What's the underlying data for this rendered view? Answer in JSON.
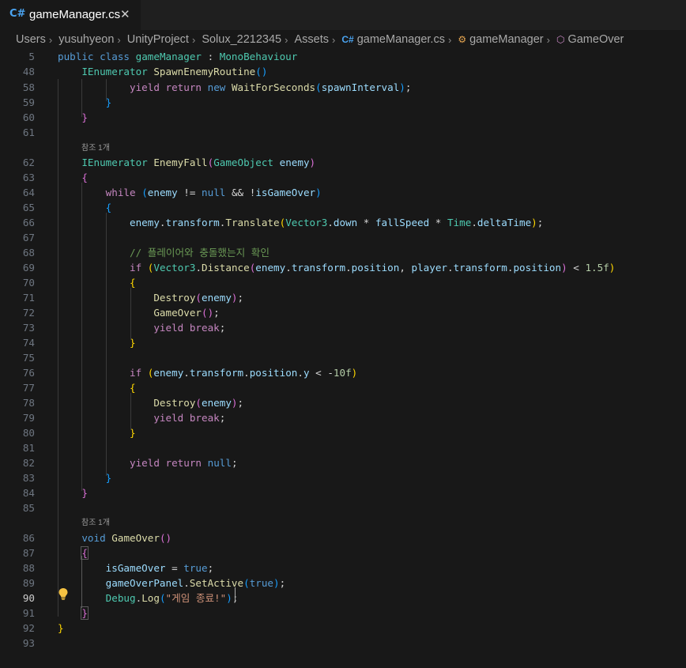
{
  "tab": {
    "icon": "csharp-icon",
    "label": "gameManager.cs",
    "close_glyph": "✕"
  },
  "breadcrumb": {
    "items": [
      "Users",
      "yusuhyeon",
      "UnityProject",
      "Solux_2212345",
      "Assets",
      "gameManager.cs",
      "gameManager",
      "GameOver"
    ]
  },
  "codelens": {
    "ref1": "참조 1개",
    "ref2": "참조 1개"
  },
  "sticky": [
    {
      "ln": "5",
      "tokens": [
        [
          "kw",
          "public"
        ],
        [
          "op",
          " "
        ],
        [
          "kw",
          "class"
        ],
        [
          "op",
          " "
        ],
        [
          "ty",
          "gameManager"
        ],
        [
          "op",
          " : "
        ],
        [
          "ty",
          "MonoBehaviour"
        ]
      ]
    },
    {
      "ln": "48",
      "tokens": [
        [
          "op",
          "    "
        ],
        [
          "ty",
          "IEnumerator"
        ],
        [
          "op",
          " "
        ],
        [
          "fn",
          "SpawnEnemyRoutine"
        ],
        [
          "p3",
          "()"
        ]
      ]
    }
  ],
  "lines": [
    {
      "ln": "58",
      "tokens": [
        [
          "op",
          "            "
        ],
        [
          "ctl",
          "yield"
        ],
        [
          "op",
          " "
        ],
        [
          "ctl",
          "return"
        ],
        [
          "op",
          " "
        ],
        [
          "kw",
          "new"
        ],
        [
          "op",
          " "
        ],
        [
          "fn",
          "WaitForSeconds"
        ],
        [
          "p3",
          "("
        ],
        [
          "var",
          "spawnInterval"
        ],
        [
          "p3",
          ")"
        ],
        [
          "op",
          ";"
        ]
      ]
    },
    {
      "ln": "59",
      "tokens": [
        [
          "op",
          "        "
        ],
        [
          "p3",
          "}"
        ]
      ]
    },
    {
      "ln": "60",
      "tokens": [
        [
          "op",
          "    "
        ],
        [
          "p2",
          "}"
        ]
      ]
    },
    {
      "ln": "61",
      "tokens": []
    },
    {
      "ln": "62",
      "tokens": [
        [
          "op",
          "    "
        ],
        [
          "ty",
          "IEnumerator"
        ],
        [
          "op",
          " "
        ],
        [
          "fn",
          "EnemyFall"
        ],
        [
          "p2",
          "("
        ],
        [
          "ty",
          "GameObject"
        ],
        [
          "op",
          " "
        ],
        [
          "var",
          "enemy"
        ],
        [
          "p2",
          ")"
        ]
      ]
    },
    {
      "ln": "63",
      "tokens": [
        [
          "op",
          "    "
        ],
        [
          "p2",
          "{"
        ]
      ]
    },
    {
      "ln": "64",
      "tokens": [
        [
          "op",
          "        "
        ],
        [
          "ctl",
          "while"
        ],
        [
          "op",
          " "
        ],
        [
          "p3",
          "("
        ],
        [
          "var",
          "enemy"
        ],
        [
          "op",
          " != "
        ],
        [
          "kw",
          "null"
        ],
        [
          "op",
          " && !"
        ],
        [
          "var",
          "isGameOver"
        ],
        [
          "p3",
          ")"
        ]
      ]
    },
    {
      "ln": "65",
      "tokens": [
        [
          "op",
          "        "
        ],
        [
          "p3",
          "{"
        ]
      ]
    },
    {
      "ln": "66",
      "tokens": [
        [
          "op",
          "            "
        ],
        [
          "var",
          "enemy"
        ],
        [
          "op",
          "."
        ],
        [
          "var",
          "transform"
        ],
        [
          "op",
          "."
        ],
        [
          "fn",
          "Translate"
        ],
        [
          "p1",
          "("
        ],
        [
          "ty",
          "Vector3"
        ],
        [
          "op",
          "."
        ],
        [
          "var",
          "down"
        ],
        [
          "op",
          " * "
        ],
        [
          "var",
          "fallSpeed"
        ],
        [
          "op",
          " * "
        ],
        [
          "ty",
          "Time"
        ],
        [
          "op",
          "."
        ],
        [
          "var",
          "deltaTime"
        ],
        [
          "p1",
          ")"
        ],
        [
          "op",
          ";"
        ]
      ]
    },
    {
      "ln": "67",
      "tokens": []
    },
    {
      "ln": "68",
      "tokens": [
        [
          "op",
          "            "
        ],
        [
          "cm",
          "// 플레이어와 충돌했는지 확인"
        ]
      ]
    },
    {
      "ln": "69",
      "tokens": [
        [
          "op",
          "            "
        ],
        [
          "ctl",
          "if"
        ],
        [
          "op",
          " "
        ],
        [
          "p1",
          "("
        ],
        [
          "ty",
          "Vector3"
        ],
        [
          "op",
          "."
        ],
        [
          "fn",
          "Distance"
        ],
        [
          "p2",
          "("
        ],
        [
          "var",
          "enemy"
        ],
        [
          "op",
          "."
        ],
        [
          "var",
          "transform"
        ],
        [
          "op",
          "."
        ],
        [
          "var",
          "position"
        ],
        [
          "op",
          ", "
        ],
        [
          "var",
          "player"
        ],
        [
          "op",
          "."
        ],
        [
          "var",
          "transform"
        ],
        [
          "op",
          "."
        ],
        [
          "var",
          "position"
        ],
        [
          "p2",
          ")"
        ],
        [
          "op",
          " < "
        ],
        [
          "num",
          "1.5f"
        ],
        [
          "p1",
          ")"
        ]
      ]
    },
    {
      "ln": "70",
      "tokens": [
        [
          "op",
          "            "
        ],
        [
          "p1",
          "{"
        ]
      ]
    },
    {
      "ln": "71",
      "tokens": [
        [
          "op",
          "                "
        ],
        [
          "fn",
          "Destroy"
        ],
        [
          "p2",
          "("
        ],
        [
          "var",
          "enemy"
        ],
        [
          "p2",
          ")"
        ],
        [
          "op",
          ";"
        ]
      ]
    },
    {
      "ln": "72",
      "tokens": [
        [
          "op",
          "                "
        ],
        [
          "fn",
          "GameOver"
        ],
        [
          "p2",
          "()"
        ],
        [
          "op",
          ";"
        ]
      ]
    },
    {
      "ln": "73",
      "tokens": [
        [
          "op",
          "                "
        ],
        [
          "ctl",
          "yield"
        ],
        [
          "op",
          " "
        ],
        [
          "ctl",
          "break"
        ],
        [
          "op",
          ";"
        ]
      ]
    },
    {
      "ln": "74",
      "tokens": [
        [
          "op",
          "            "
        ],
        [
          "p1",
          "}"
        ]
      ]
    },
    {
      "ln": "75",
      "tokens": []
    },
    {
      "ln": "76",
      "tokens": [
        [
          "op",
          "            "
        ],
        [
          "ctl",
          "if"
        ],
        [
          "op",
          " "
        ],
        [
          "p1",
          "("
        ],
        [
          "var",
          "enemy"
        ],
        [
          "op",
          "."
        ],
        [
          "var",
          "transform"
        ],
        [
          "op",
          "."
        ],
        [
          "var",
          "position"
        ],
        [
          "op",
          "."
        ],
        [
          "var",
          "y"
        ],
        [
          "op",
          " < -"
        ],
        [
          "num",
          "10f"
        ],
        [
          "p1",
          ")"
        ]
      ]
    },
    {
      "ln": "77",
      "tokens": [
        [
          "op",
          "            "
        ],
        [
          "p1",
          "{"
        ]
      ]
    },
    {
      "ln": "78",
      "tokens": [
        [
          "op",
          "                "
        ],
        [
          "fn",
          "Destroy"
        ],
        [
          "p2",
          "("
        ],
        [
          "var",
          "enemy"
        ],
        [
          "p2",
          ")"
        ],
        [
          "op",
          ";"
        ]
      ]
    },
    {
      "ln": "79",
      "tokens": [
        [
          "op",
          "                "
        ],
        [
          "ctl",
          "yield"
        ],
        [
          "op",
          " "
        ],
        [
          "ctl",
          "break"
        ],
        [
          "op",
          ";"
        ]
      ]
    },
    {
      "ln": "80",
      "tokens": [
        [
          "op",
          "            "
        ],
        [
          "p1",
          "}"
        ]
      ]
    },
    {
      "ln": "81",
      "tokens": []
    },
    {
      "ln": "82",
      "tokens": [
        [
          "op",
          "            "
        ],
        [
          "ctl",
          "yield"
        ],
        [
          "op",
          " "
        ],
        [
          "ctl",
          "return"
        ],
        [
          "op",
          " "
        ],
        [
          "kw",
          "null"
        ],
        [
          "op",
          ";"
        ]
      ]
    },
    {
      "ln": "83",
      "tokens": [
        [
          "op",
          "        "
        ],
        [
          "p3",
          "}"
        ]
      ]
    },
    {
      "ln": "84",
      "tokens": [
        [
          "op",
          "    "
        ],
        [
          "p2",
          "}"
        ]
      ]
    },
    {
      "ln": "85",
      "tokens": []
    },
    {
      "ln": "86",
      "tokens": [
        [
          "op",
          "    "
        ],
        [
          "kw",
          "void"
        ],
        [
          "op",
          " "
        ],
        [
          "fn",
          "GameOver"
        ],
        [
          "p2",
          "()"
        ]
      ]
    },
    {
      "ln": "87",
      "tokens": [
        [
          "op",
          "    "
        ],
        [
          "p2",
          "{"
        ]
      ]
    },
    {
      "ln": "88",
      "tokens": [
        [
          "op",
          "        "
        ],
        [
          "var",
          "isGameOver"
        ],
        [
          "op",
          " = "
        ],
        [
          "kw",
          "true"
        ],
        [
          "op",
          ";"
        ]
      ]
    },
    {
      "ln": "89",
      "tokens": [
        [
          "op",
          "        "
        ],
        [
          "var",
          "gameOverPanel"
        ],
        [
          "op",
          "."
        ],
        [
          "fn",
          "SetActive"
        ],
        [
          "p3",
          "("
        ],
        [
          "kw",
          "true"
        ],
        [
          "p3",
          ")"
        ],
        [
          "op",
          ";"
        ]
      ]
    },
    {
      "ln": "90",
      "tokens": [
        [
          "op",
          "        "
        ],
        [
          "ty",
          "Debug"
        ],
        [
          "op",
          "."
        ],
        [
          "fn",
          "Log"
        ],
        [
          "p3",
          "("
        ],
        [
          "str",
          "\"게임 종료!\""
        ],
        [
          "p3",
          ")"
        ],
        [
          "op",
          ";"
        ]
      ]
    },
    {
      "ln": "91",
      "tokens": [
        [
          "op",
          "    "
        ],
        [
          "p2",
          "}"
        ]
      ]
    },
    {
      "ln": "92",
      "tokens": [
        [
          "p1",
          "}"
        ]
      ]
    },
    {
      "ln": "93",
      "tokens": []
    }
  ],
  "current_line": "90",
  "lightbulb": "lightbulb-icon"
}
